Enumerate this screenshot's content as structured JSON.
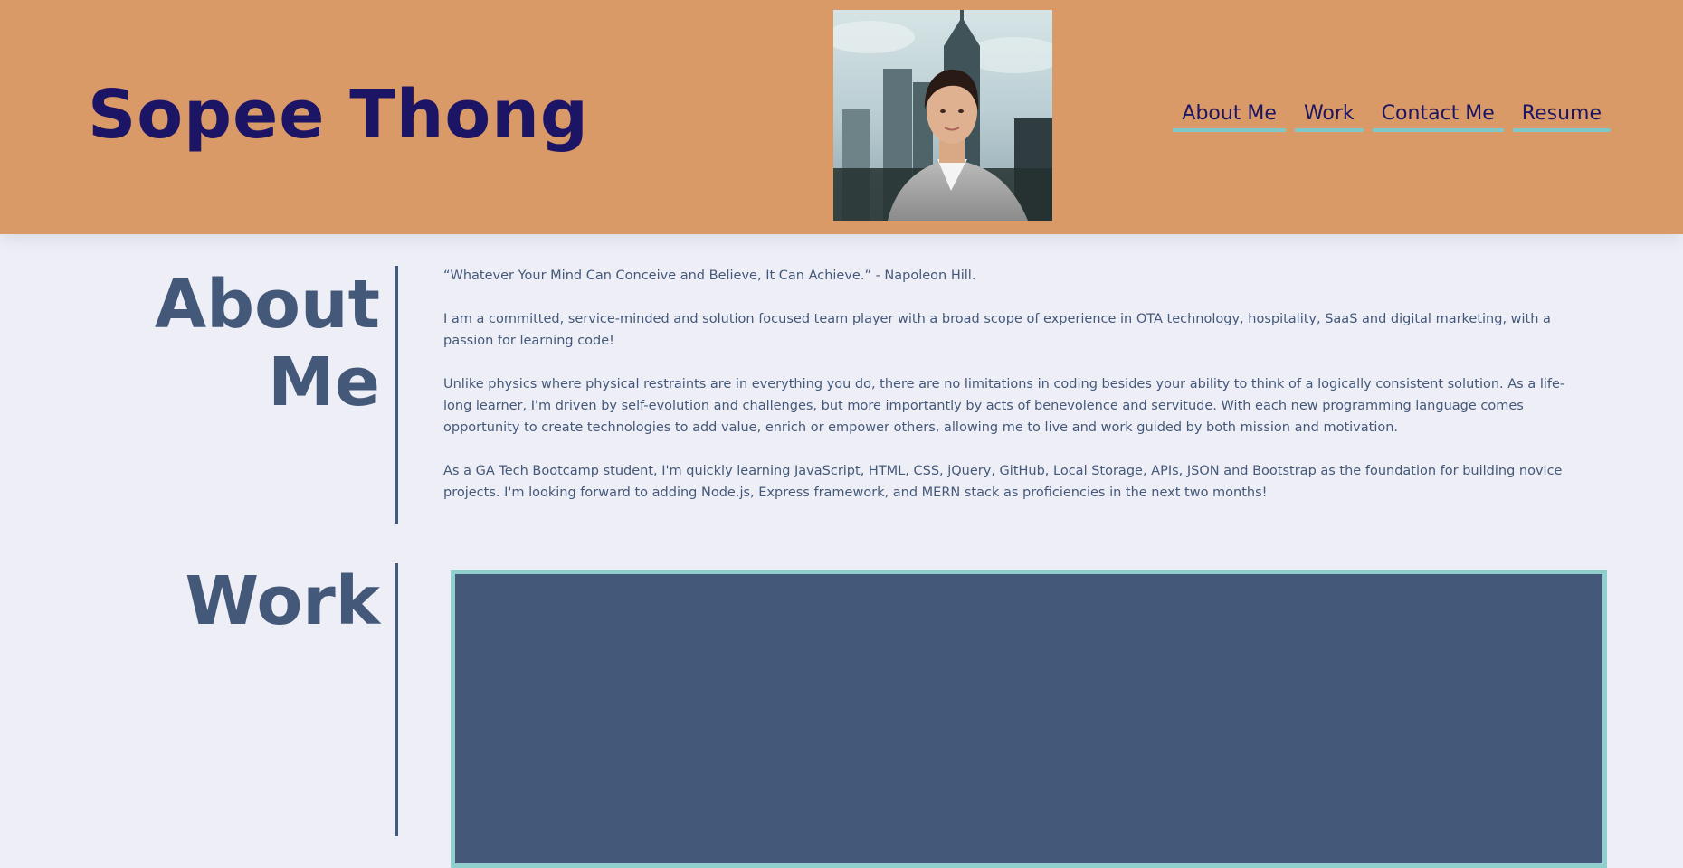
{
  "header": {
    "site_title": "Sopee Thong",
    "nav": [
      {
        "label": "About Me"
      },
      {
        "label": "Work"
      },
      {
        "label": "Contact Me"
      },
      {
        "label": "Resume"
      }
    ]
  },
  "about": {
    "heading_line1": "About",
    "heading_line2": "Me",
    "paragraphs": [
      "“Whatever Your Mind Can Conceive and Believe, It Can Achieve.” - Napoleon Hill.",
      "I am a committed, service-minded and solution focused team player with a broad scope of experience in OTA technology, hospitality, SaaS and digital marketing, with a passion for learning code!",
      "Unlike physics where physical restraints are in everything you do, there are no limitations in coding besides your ability to think of a logically consistent solution. As a life-long learner, I'm driven by self-evolution and challenges, but more importantly by acts of benevolence and servitude. With each new programming language comes opportunity to create technologies to add value, enrich or empower others, allowing me to live and work guided by both mission and motivation.",
      "As a GA Tech Bootcamp student, I'm quickly learning JavaScript, HTML, CSS, jQuery, GitHub, Local Storage, APIs, JSON and Bootstrap as the foundation for building novice projects. I'm looking forward to adding Node.js, Express framework, and MERN stack as proficiencies in the next two months!"
    ]
  },
  "work": {
    "heading": "Work"
  },
  "colors": {
    "header_bg": "#d99a67",
    "title": "#1c1464",
    "accent": "#7ec8c8",
    "slate": "#44597a",
    "page_bg": "#eeeef6"
  }
}
